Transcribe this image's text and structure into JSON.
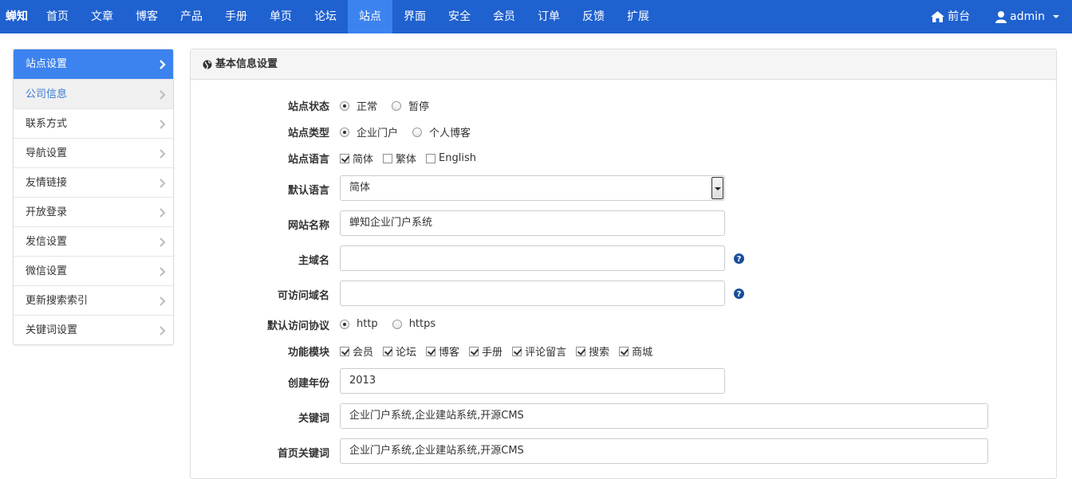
{
  "nav": {
    "brand": "蝉知",
    "items": [
      "首页",
      "文章",
      "博客",
      "产品",
      "手册",
      "单页",
      "论坛",
      "站点",
      "界面",
      "安全",
      "会员",
      "订单",
      "反馈",
      "扩展"
    ],
    "active_index": 7,
    "front_label": "前台",
    "user_label": "admin"
  },
  "sidebar": {
    "items": [
      "站点设置",
      "公司信息",
      "联系方式",
      "导航设置",
      "友情链接",
      "开放登录",
      "发信设置",
      "微信设置",
      "更新搜索索引",
      "关键词设置"
    ],
    "active_index": 0,
    "hover_index": 1
  },
  "panel": {
    "title": "基本信息设置"
  },
  "form": {
    "status": {
      "label": "站点状态",
      "options": [
        "正常",
        "暂停"
      ],
      "selected": 0
    },
    "type": {
      "label": "站点类型",
      "options": [
        "企业门户",
        "个人博客"
      ],
      "selected": 0
    },
    "lang": {
      "label": "站点语言",
      "options": [
        "简体",
        "繁体",
        "English"
      ],
      "checked": [
        true,
        false,
        false
      ]
    },
    "default_lang": {
      "label": "默认语言",
      "value": "简体"
    },
    "site_name": {
      "label": "网站名称",
      "value": "蝉知企业门户系统"
    },
    "domain": {
      "label": "主域名",
      "value": ""
    },
    "alt_domain": {
      "label": "可访问域名",
      "value": ""
    },
    "protocol": {
      "label": "默认访问协议",
      "options": [
        "http",
        "https"
      ],
      "selected": 0
    },
    "modules": {
      "label": "功能模块",
      "options": [
        "会员",
        "论坛",
        "博客",
        "手册",
        "评论留言",
        "搜索",
        "商城"
      ],
      "checked": [
        true,
        true,
        true,
        true,
        true,
        true,
        true
      ]
    },
    "year": {
      "label": "创建年份",
      "value": "2013"
    },
    "keywords": {
      "label": "关键词",
      "value": "企业门户系统,企业建站系统,开源CMS"
    },
    "home_keywords": {
      "label": "首页关键词",
      "value": "企业门户系统,企业建站系统,开源CMS"
    }
  },
  "colors": {
    "navbar": "#1f61cf",
    "active": "#3c83f0",
    "help_icon": "#1a4e9c"
  }
}
